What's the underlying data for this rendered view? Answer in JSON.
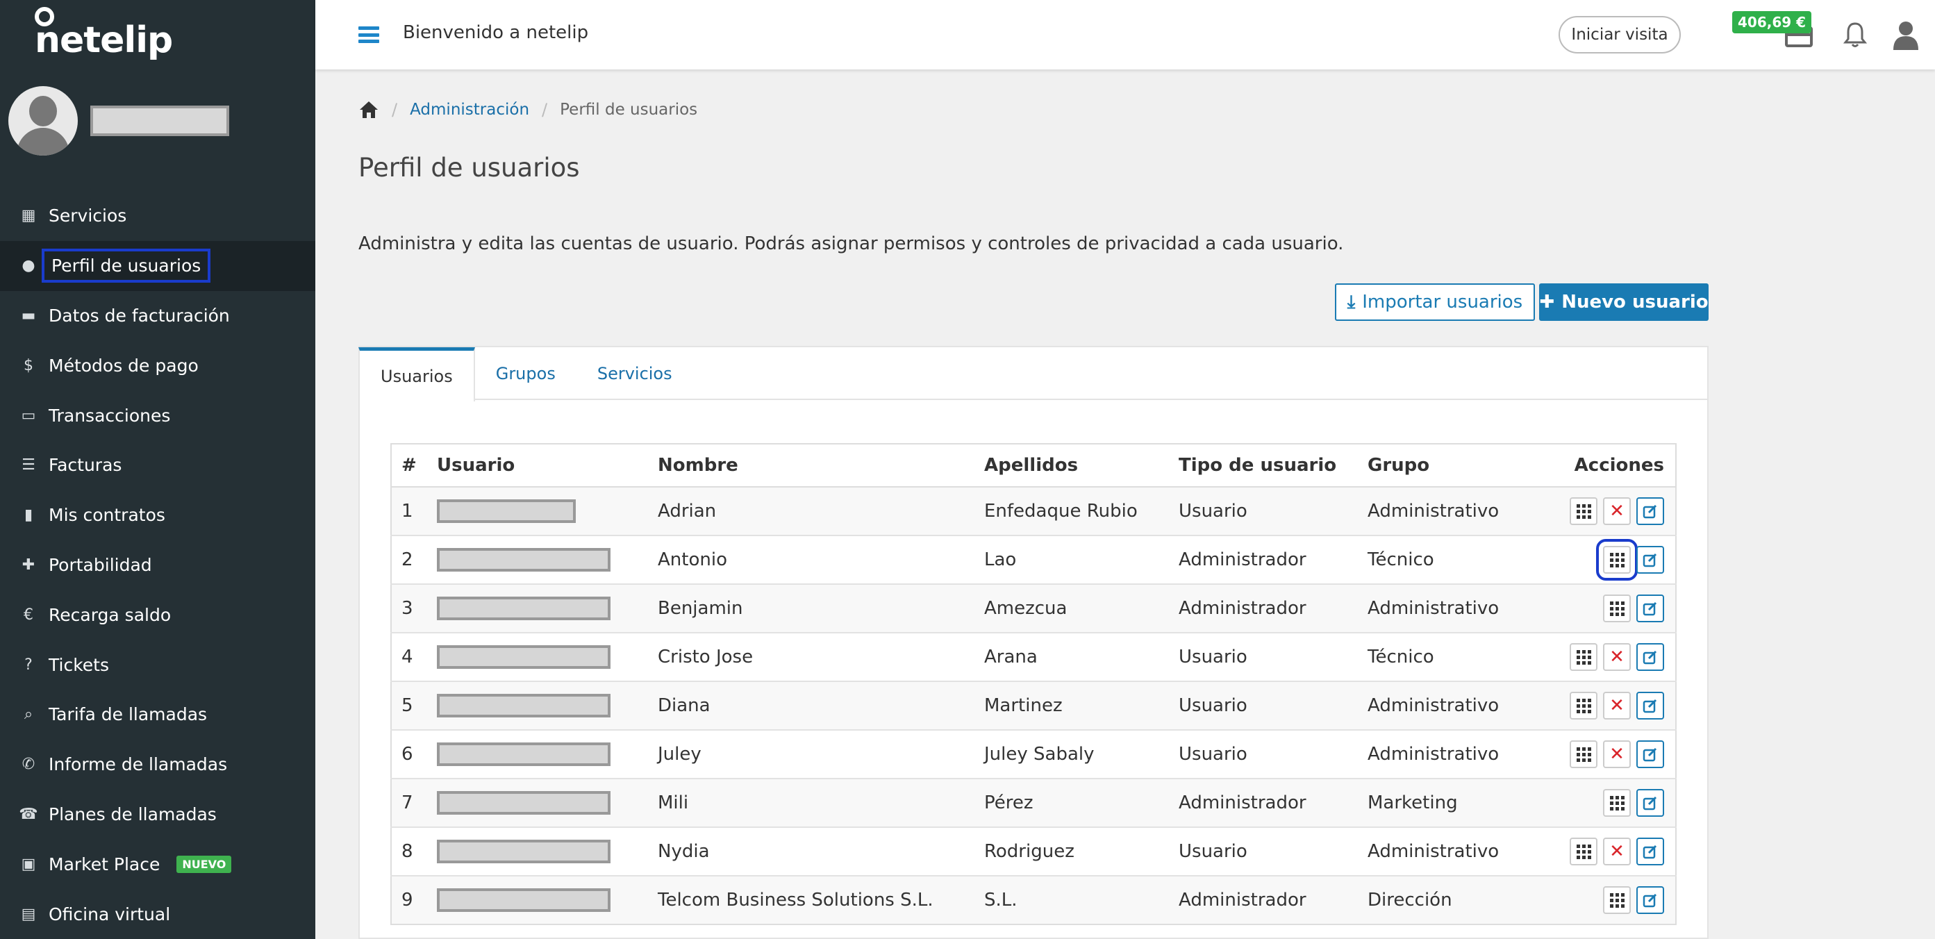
{
  "app": {
    "logo_text": "netelip",
    "welcome": "Bienvenido a netelip",
    "visit_button": "Iniciar visita",
    "balance": "406,69 €"
  },
  "sidebar": {
    "items": [
      {
        "label": "Servicios",
        "icon": "grid-icon"
      },
      {
        "label": "Perfil de usuarios",
        "icon": "user-icon"
      },
      {
        "label": "Datos de facturación",
        "icon": "briefcase-icon"
      },
      {
        "label": "Métodos de pago",
        "icon": "dollar-icon"
      },
      {
        "label": "Transacciones",
        "icon": "credit-card-icon"
      },
      {
        "label": "Facturas",
        "icon": "list-icon"
      },
      {
        "label": "Mis contratos",
        "icon": "file-icon"
      },
      {
        "label": "Portabilidad",
        "icon": "plus-icon"
      },
      {
        "label": "Recarga saldo",
        "icon": "euro-icon"
      },
      {
        "label": "Tickets",
        "icon": "question-icon"
      },
      {
        "label": "Tarifa de llamadas",
        "icon": "search-icon"
      },
      {
        "label": "Informe de llamadas",
        "icon": "phone-icon"
      },
      {
        "label": "Planes de llamadas",
        "icon": "deskphone-icon"
      },
      {
        "label": "Market Place",
        "icon": "monitor-icon",
        "badge": "NUEVO"
      },
      {
        "label": "Oficina virtual",
        "icon": "building-icon"
      }
    ]
  },
  "breadcrumb": {
    "link": "Administración",
    "current": "Perfil de usuarios"
  },
  "page": {
    "title": "Perfil de usuarios",
    "description": "Administra y edita las cuentas de usuario. Podrás asignar permisos y controles de privacidad a cada usuario.",
    "import_button": "Importar usuarios",
    "new_button": "Nuevo usuario"
  },
  "tabs": [
    "Usuarios",
    "Grupos",
    "Servicios"
  ],
  "table": {
    "headers": [
      "#",
      "Usuario",
      "Nombre",
      "Apellidos",
      "Tipo de usuario",
      "Grupo",
      "Acciones"
    ],
    "rows": [
      {
        "num": "1",
        "nombre": "Adrian",
        "apellidos": "Enfedaque Rubio",
        "tipo": "Usuario",
        "grupo": "Administrativo",
        "can_delete": true
      },
      {
        "num": "2",
        "nombre": "Antonio",
        "apellidos": "Lao",
        "tipo": "Administrador",
        "grupo": "Técnico",
        "can_delete": false
      },
      {
        "num": "3",
        "nombre": "Benjamin",
        "apellidos": "Amezcua",
        "tipo": "Administrador",
        "grupo": "Administrativo",
        "can_delete": false
      },
      {
        "num": "4",
        "nombre": "Cristo Jose",
        "apellidos": "Arana",
        "tipo": "Usuario",
        "grupo": "Técnico",
        "can_delete": true
      },
      {
        "num": "5",
        "nombre": "Diana",
        "apellidos": "Martinez",
        "tipo": "Usuario",
        "grupo": "Administrativo",
        "can_delete": true
      },
      {
        "num": "6",
        "nombre": "Juley",
        "apellidos": "Juley Sabaly",
        "tipo": "Usuario",
        "grupo": "Administrativo",
        "can_delete": true
      },
      {
        "num": "7",
        "nombre": "Mili",
        "apellidos": "Pérez",
        "tipo": "Administrador",
        "grupo": "Marketing",
        "can_delete": false
      },
      {
        "num": "8",
        "nombre": "Nydia",
        "apellidos": "Rodriguez",
        "tipo": "Usuario",
        "grupo": "Administrativo",
        "can_delete": true
      },
      {
        "num": "9",
        "nombre": "Telcom Business Solutions S.L.",
        "apellidos": "S.L.",
        "tipo": "Administrador",
        "grupo": "Dirección",
        "can_delete": false
      }
    ]
  },
  "colors": {
    "sidebar_bg": "#253035",
    "accent": "#1a7bb3",
    "balance_badge": "#2fb04a",
    "delete_red": "#d9242a"
  }
}
